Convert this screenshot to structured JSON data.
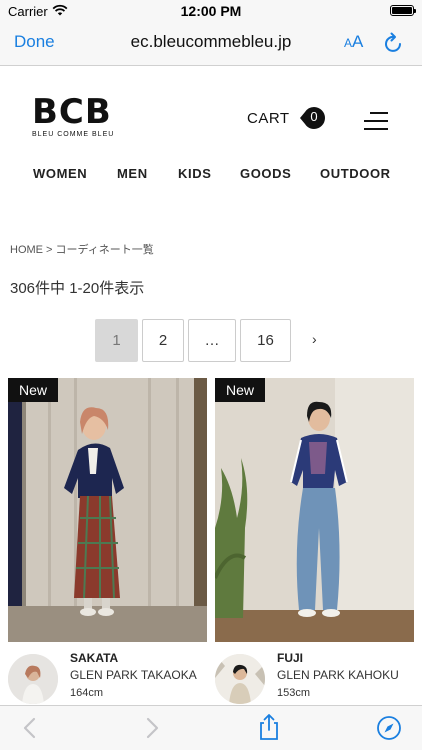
{
  "status_bar": {
    "carrier": "Carrier",
    "time": "12:00 PM"
  },
  "browser": {
    "done_label": "Done",
    "url": "ec.bleucommebleu.jp",
    "text_size_small": "A",
    "text_size_big": "A"
  },
  "header": {
    "logo_main": "BCB",
    "logo_sub": "BLEU COMME BLEU",
    "cart_label": "CART",
    "cart_count": "0"
  },
  "categories": [
    "WOMEN",
    "MEN",
    "KIDS",
    "GOODS",
    "OUTDOOR"
  ],
  "breadcrumb": "HOME > コーディネート一覧",
  "result_count": "306件中 1-20件表示",
  "pagination": {
    "pages": [
      "1",
      "2",
      "…",
      "16"
    ],
    "current": "1",
    "next": "›"
  },
  "cards": [
    {
      "tag": "New",
      "name": "SAKATA",
      "store": "GLEN PARK TAKAOKA",
      "height": "164cm"
    },
    {
      "tag": "New",
      "name": "FUJI",
      "store": "GLEN PARK KAHOKU",
      "height": "153cm"
    }
  ],
  "colors": {
    "ios_blue": "#1a7fe0",
    "ink": "#111111",
    "active_page_bg": "#d8d8d8"
  }
}
